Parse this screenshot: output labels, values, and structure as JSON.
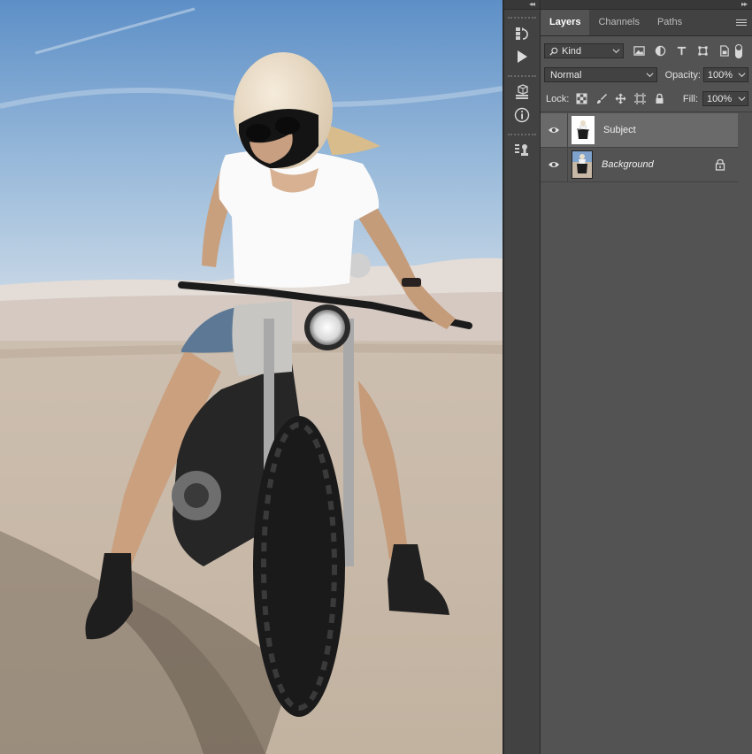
{
  "canvas": {
    "description_icon": "photo-canvas"
  },
  "toolcolumn": {
    "collapse_glyph": "◂◂",
    "tools": [
      {
        "name": "history-icon"
      },
      {
        "name": "play-icon"
      },
      {
        "name": "3d-cube-icon"
      },
      {
        "name": "info-icon"
      },
      {
        "name": "clone-source-icon"
      }
    ]
  },
  "panel": {
    "collapse_glyph": "▸▸",
    "tabs": [
      {
        "label": "Layers",
        "active": true
      },
      {
        "label": "Channels",
        "active": false
      },
      {
        "label": "Paths",
        "active": false
      }
    ],
    "filter": {
      "kind_value": "Kind"
    },
    "blend": {
      "mode_value": "Normal",
      "opacity_label": "Opacity:",
      "opacity_value": "100%"
    },
    "lock": {
      "label": "Lock:",
      "fill_label": "Fill:",
      "fill_value": "100%"
    },
    "layers": [
      {
        "name": "Subject",
        "selected": true,
        "visible": true,
        "locked": false
      },
      {
        "name": "Background",
        "selected": false,
        "visible": true,
        "locked": true
      }
    ]
  },
  "colors": {
    "panel_bg": "#535353",
    "dark_bg": "#424242",
    "selected_layer": "#6a6a6a"
  }
}
